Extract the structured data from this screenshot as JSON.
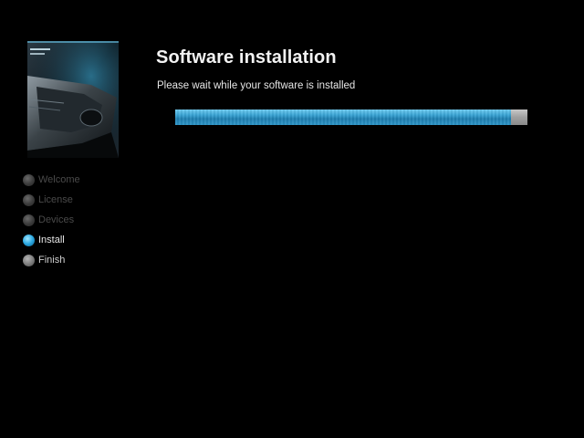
{
  "header": {
    "title": "Software installation",
    "subtitle": "Please wait while your software is installed"
  },
  "progress": {
    "fraction": 0.953
  },
  "steps": [
    {
      "label": "Welcome",
      "state": "inactive"
    },
    {
      "label": "License",
      "state": "inactive"
    },
    {
      "label": "Devices",
      "state": "inactive"
    },
    {
      "label": "Install",
      "state": "current"
    },
    {
      "label": "Finish",
      "state": "upcoming"
    }
  ],
  "colors": {
    "background": "#000000",
    "accent": "#2aa7e0",
    "title": "#f2f2f2"
  },
  "product_box": {
    "icon": "product-box-image"
  }
}
